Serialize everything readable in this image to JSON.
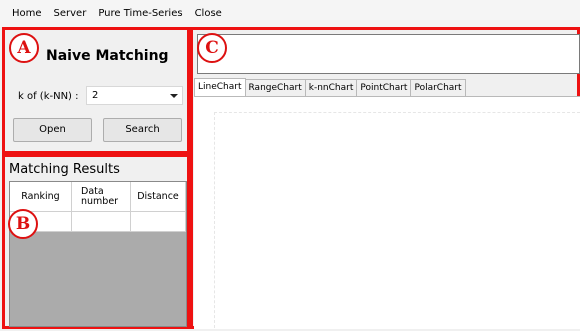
{
  "menu": [
    "Home",
    "Server",
    "Pure Time-Series",
    "Close"
  ],
  "markers": {
    "a": "A",
    "b": "B",
    "c": "C"
  },
  "panel_a": {
    "title": "Naive Matching",
    "k_label": "k of (k-NN) :",
    "k_value": "2",
    "open_label": "Open",
    "search_label": "Search"
  },
  "panel_b": {
    "title": "Matching Results",
    "columns": [
      "Ranking",
      "Data number",
      "Distance"
    ]
  },
  "panel_c": {
    "tabs": [
      "LineChart",
      "RangeChart",
      "k-nnChart",
      "PointChart",
      "PolarChart"
    ],
    "active_tab": "LineChart"
  },
  "colors": {
    "annotation": "#e11111"
  }
}
